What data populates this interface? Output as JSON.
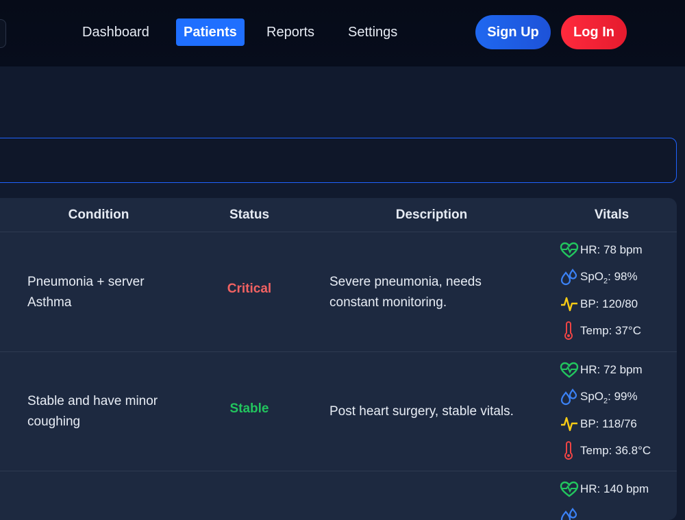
{
  "nav": {
    "links": [
      {
        "label": "Dashboard",
        "active": false
      },
      {
        "label": "Patients",
        "active": true
      },
      {
        "label": "Reports",
        "active": false
      },
      {
        "label": "Settings",
        "active": false
      }
    ],
    "signup_label": "Sign Up",
    "login_label": "Log In"
  },
  "table": {
    "headers": {
      "condition": "Condition",
      "status": "Status",
      "description": "Description",
      "vitals": "Vitals"
    },
    "rows": [
      {
        "condition_line1": "Pneumonia + server",
        "condition_line2": "Asthma",
        "status": "Critical",
        "description_line1": "Severe pneumonia, needs",
        "description_line2": "constant monitoring.",
        "hr": "HR: 78 bpm",
        "spo2_label": "SpO",
        "spo2_sub": "2",
        "spo2_value": ": 98%",
        "bp": "BP: 120/80",
        "temp": "Temp: 37°C"
      },
      {
        "condition_line1": "Stable and have minor",
        "condition_line2": "coughing",
        "status": "Stable",
        "description_line1": "Post heart surgery, stable vitals.",
        "description_line2": "",
        "hr": "HR: 72 bpm",
        "spo2_label": "SpO",
        "spo2_sub": "2",
        "spo2_value": ": 99%",
        "bp": "BP: 118/76",
        "temp": "Temp: 36.8°C"
      },
      {
        "hr": "HR: 140 bpm"
      }
    ]
  },
  "colors": {
    "accent": "#1f6fff",
    "critical": "#f26262",
    "stable": "#22c55e",
    "heart": "#22c55e",
    "drop": "#3b82f6",
    "bp": "#facc15",
    "temp": "#ef4444"
  }
}
